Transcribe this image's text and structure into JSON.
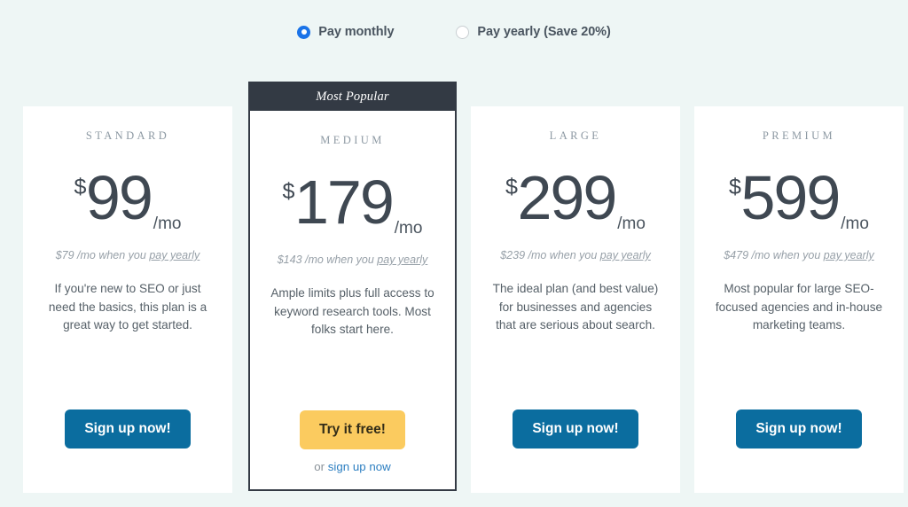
{
  "billing": {
    "options": [
      {
        "label": "Pay monthly",
        "selected": true,
        "icon": "radio-selected-icon"
      },
      {
        "label": "Pay yearly (Save 20%)",
        "selected": false,
        "icon": "radio-unselected-icon"
      }
    ],
    "accent_color": "#1a73e8"
  },
  "colors": {
    "page_background": "#eef6f5",
    "card_background": "#ffffff",
    "featured_border": "#333a44",
    "ribbon_background": "#333a44",
    "primary_button": "#0b6d9f",
    "accent_button": "#fbcb5f",
    "price_text": "#3f4852",
    "muted_text": "#97a0a8",
    "link_blue": "#2d7fc1"
  },
  "plans": [
    {
      "name": "STANDARD",
      "currency": "$",
      "amount": "99",
      "period": "/mo",
      "yearly_prefix": "$79 /mo when you ",
      "yearly_link": "pay yearly",
      "description": "If you're new to SEO or just need the basics, this plan is a great way to get started.",
      "cta_label": "Sign up now!",
      "featured": false,
      "ribbon": "",
      "alt_prefix": "",
      "alt_link": ""
    },
    {
      "name": "MEDIUM",
      "currency": "$",
      "amount": "179",
      "period": "/mo",
      "yearly_prefix": "$143 /mo when you ",
      "yearly_link": "pay yearly",
      "description": "Ample limits plus full access to keyword research tools. Most folks start here.",
      "cta_label": "Try it free!",
      "featured": true,
      "ribbon": "Most Popular",
      "alt_prefix": "or ",
      "alt_link": "sign up now"
    },
    {
      "name": "LARGE",
      "currency": "$",
      "amount": "299",
      "period": "/mo",
      "yearly_prefix": "$239 /mo when you ",
      "yearly_link": "pay yearly",
      "description": "The ideal plan (and best value) for businesses and agencies that are serious about search.",
      "cta_label": "Sign up now!",
      "featured": false,
      "ribbon": "",
      "alt_prefix": "",
      "alt_link": ""
    },
    {
      "name": "PREMIUM",
      "currency": "$",
      "amount": "599",
      "period": "/mo",
      "yearly_prefix": "$479 /mo when you ",
      "yearly_link": "pay yearly",
      "description": "Most popular for large SEO-focused agencies and in-house marketing teams.",
      "cta_label": "Sign up now!",
      "featured": false,
      "ribbon": "",
      "alt_prefix": "",
      "alt_link": ""
    }
  ]
}
